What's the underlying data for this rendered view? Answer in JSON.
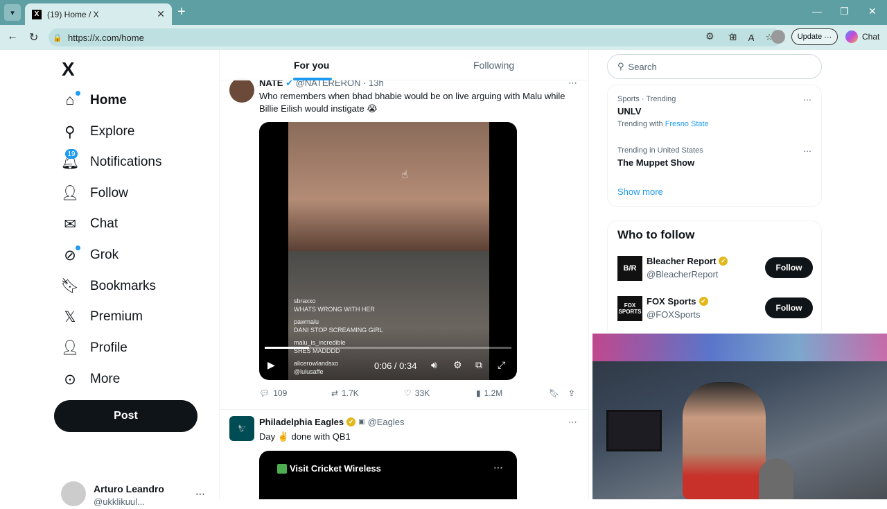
{
  "browser": {
    "tab_title": "(19) Home / X",
    "url": "https://x.com/home",
    "update_label": "Update",
    "chat_label": "Chat"
  },
  "sidebar": {
    "logo": "X",
    "items": [
      {
        "label": "Home",
        "icon": "home-icon"
      },
      {
        "label": "Explore",
        "icon": "search-icon"
      },
      {
        "label": "Notifications",
        "icon": "bell-icon",
        "badge": "19"
      },
      {
        "label": "Follow",
        "icon": "person-plus-icon"
      },
      {
        "label": "Chat",
        "icon": "mail-icon"
      },
      {
        "label": "Grok",
        "icon": "grok-icon"
      },
      {
        "label": "Bookmarks",
        "icon": "bookmark-icon"
      },
      {
        "label": "Premium",
        "icon": "x-icon"
      },
      {
        "label": "Profile",
        "icon": "person-icon"
      },
      {
        "label": "More",
        "icon": "more-circle-icon"
      }
    ],
    "post_label": "Post",
    "account": {
      "name": "Arturo Leandro",
      "handle": "@ukklikuul..."
    }
  },
  "feed": {
    "tabs": [
      "For you",
      "Following"
    ],
    "tweet1": {
      "name": "NATE",
      "handle": "@NATERERON",
      "time": "13h",
      "text": "Who remembers when bhad bhabie would be on live arguing with Malu while Billie Eilish would instigate 😭",
      "video": {
        "time": "0:06 / 0:34",
        "progress": 0.18,
        "comments": [
          {
            "user": "sbraxxo",
            "text": "WHATS WRONG WITH HER"
          },
          {
            "user": "pawmalu",
            "text": "DANI STOP SCREAMING GIRL"
          },
          {
            "user": "malu_is_incredible",
            "text": "SHES MADDDD"
          },
          {
            "user": "alicerowlandsxo",
            "text": "@lulusaffe"
          }
        ]
      },
      "stats": {
        "replies": "109",
        "reposts": "1.7K",
        "likes": "33K",
        "views": "1.2M"
      }
    },
    "tweet2": {
      "name": "Philadelphia Eagles",
      "handle": "@Eagles",
      "text": "Day ✌️ done with QB1",
      "ad_label": "Visit Cricket Wireless"
    }
  },
  "right": {
    "search_placeholder": "Search",
    "trends": [
      {
        "meta": "Sports · Trending",
        "name": "UNLV",
        "with_label": "Trending with",
        "with_link": "Fresno State"
      },
      {
        "meta": "Trending in United States",
        "name": "The Muppet Show"
      }
    ],
    "show_more": "Show more",
    "who_to_follow": {
      "title": "Who to follow",
      "accounts": [
        {
          "name": "Bleacher Report",
          "handle": "@BleacherReport",
          "logo": "B/R",
          "button": "Follow"
        },
        {
          "name": "FOX Sports",
          "handle": "@FOXSports",
          "logo": "FOX SPORTS",
          "button": "Follow"
        }
      ]
    }
  },
  "colors": {
    "accent": "#1d9bf0",
    "text": "#0f1419",
    "muted": "#536471",
    "tabbar": "#5e9fa3",
    "addrbar": "#d7ecec"
  }
}
